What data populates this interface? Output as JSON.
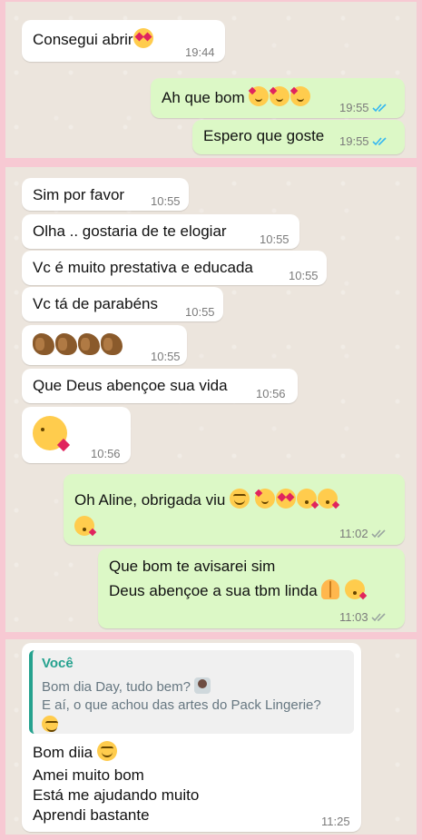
{
  "panel1": {
    "messages": [
      {
        "text": "Consegui abrir",
        "time": "19:44",
        "dir": "in"
      },
      {
        "text": "Ah que bom",
        "time": "19:55",
        "dir": "out",
        "read": true
      },
      {
        "text": "Espero que goste",
        "time": "19:55",
        "dir": "out",
        "read": true
      }
    ]
  },
  "panel2": {
    "messages": [
      {
        "text": "Sim por favor",
        "time": "10:55"
      },
      {
        "text": "Olha .. gostaria de te elogiar",
        "time": "10:55"
      },
      {
        "text": "Vc é muito prestativa e educada",
        "time": "10:55"
      },
      {
        "text": "Vc tá de parabéns",
        "time": "10:55"
      },
      {
        "text": "",
        "time": "10:55"
      },
      {
        "text": "Que Deus abençoe sua vida",
        "time": "10:56"
      },
      {
        "text": "",
        "time": "10:56"
      }
    ],
    "out1": {
      "text": "Oh Aline, obrigada viu",
      "time": "11:02"
    },
    "out2": {
      "line1": "Que bom te avisarei sim",
      "line2": "Deus abençoe a sua tbm linda",
      "time": "11:03"
    }
  },
  "panel3": {
    "quote": {
      "author": "Você",
      "line1": "Bom dia Day, tudo bem?",
      "line2": "E aí, o que achou das artes do Pack Lingerie?"
    },
    "lines": [
      "Bom diia",
      "Amei muito bom",
      "Está me ajudando muito",
      "Aprendi bastante"
    ],
    "time": "11:25"
  },
  "colors": {
    "frame": "#f7c9d3",
    "chat_bg": "#ece5dd",
    "incoming": "#ffffff",
    "outgoing": "#dcf8c6",
    "read_ticks": "#34b7f1",
    "quote_accent": "#25a28f"
  },
  "icons": [
    "smiling-face-with-hearts-icon",
    "heart-eyes-icon",
    "face-blowing-kiss-icon",
    "smiling-face-icon",
    "clapping-hands-icon",
    "folded-hands-icon",
    "read-ticks-icon",
    "woman-technologist-icon"
  ]
}
